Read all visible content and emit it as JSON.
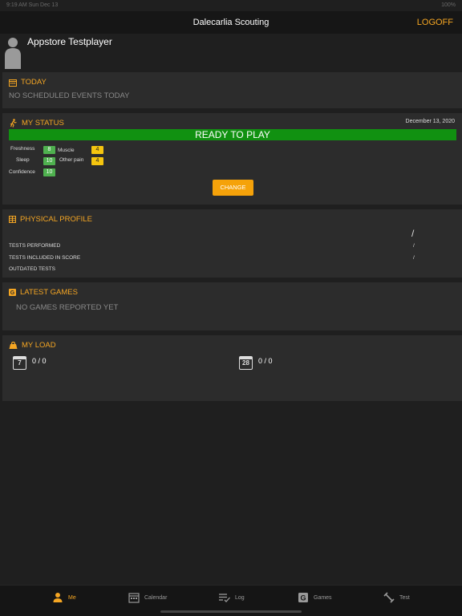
{
  "status_bar": {
    "time": "9:19 AM   Sun Dec 13",
    "battery": "100%"
  },
  "header": {
    "title": "Dalecarlia Scouting",
    "logoff": "LOGOFF"
  },
  "player": {
    "name": "Appstore Testplayer"
  },
  "today": {
    "title": "TODAY",
    "empty": "NO SCHEDULED EVENTS TODAY"
  },
  "status": {
    "title": "MY STATUS",
    "date": "December 13, 2020",
    "ready": "READY TO PLAY",
    "metrics": {
      "freshness": {
        "label": "Freshness",
        "value": "8"
      },
      "muscle": {
        "label": "Muscle",
        "value": "4"
      },
      "sleep": {
        "label": "Sleep",
        "value": "10"
      },
      "other_pain": {
        "label": "Other pain",
        "value": "4"
      },
      "confidence": {
        "label": "Confidence",
        "value": "10"
      }
    },
    "change": "CHANGE"
  },
  "physical": {
    "title": "PHYSICAL PROFILE",
    "rows": [
      {
        "label": "TESTS PERFORMED",
        "value": "/"
      },
      {
        "label": "TESTS INCLUDED IN SCORE",
        "value": "/"
      },
      {
        "label": "OUTDATED TESTS",
        "value": ""
      }
    ],
    "summary": "/"
  },
  "games": {
    "title": "LATEST GAMES",
    "empty": "NO GAMES REPORTED YET"
  },
  "load": {
    "title": "MY LOAD",
    "items": [
      {
        "day": "7",
        "value": "0 / 0"
      },
      {
        "day": "28",
        "value": "0 / 0"
      }
    ]
  },
  "tabs": [
    {
      "label": "Me",
      "icon": "person-icon",
      "active": true
    },
    {
      "label": "Calendar",
      "icon": "calendar-icon"
    },
    {
      "label": "Log",
      "icon": "log-icon"
    },
    {
      "label": "Games",
      "icon": "games-icon"
    },
    {
      "label": "Test",
      "icon": "test-icon"
    }
  ],
  "colors": {
    "accent": "#f5a623",
    "ready": "#119111",
    "good": "#4fb14f",
    "warn": "#f5c50f"
  }
}
